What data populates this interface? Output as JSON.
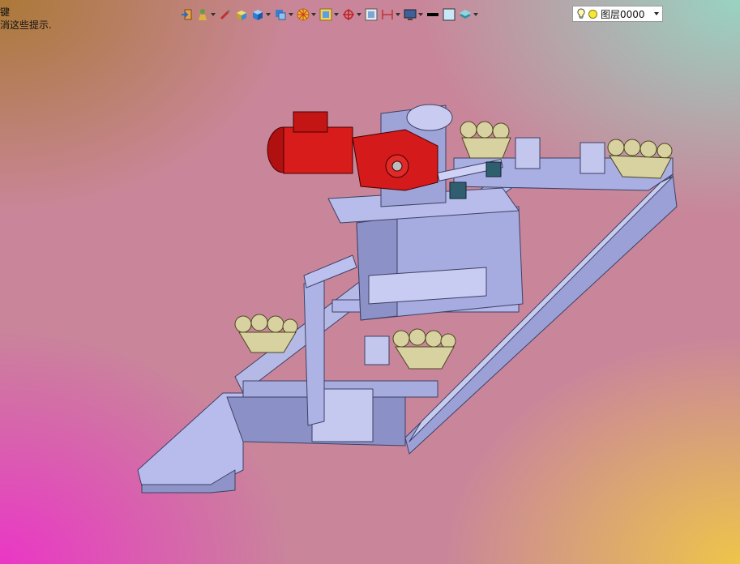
{
  "hints": {
    "line1": "键",
    "line2": "消这些提示."
  },
  "toolbar": {
    "items": [
      {
        "name": "exit-icon",
        "dropdown": false
      },
      {
        "name": "person-icon",
        "dropdown": true
      },
      {
        "name": "paint-brush-icon",
        "dropdown": false
      },
      {
        "name": "box-face-icon",
        "dropdown": false
      },
      {
        "name": "cube-icon",
        "dropdown": true
      },
      {
        "name": "view-cube-icon",
        "dropdown": true
      },
      {
        "name": "render-wheel-icon",
        "dropdown": true
      },
      {
        "name": "section-view-icon",
        "dropdown": true
      },
      {
        "name": "axis-icon",
        "dropdown": true
      },
      {
        "name": "frame-icon",
        "dropdown": false
      },
      {
        "name": "dimension-icon",
        "dropdown": true
      },
      {
        "name": "monitor-icon",
        "dropdown": true
      },
      {
        "name": "line-weight-icon",
        "dropdown": false
      },
      {
        "name": "color-swatch-icon",
        "dropdown": false
      },
      {
        "name": "layers-icon",
        "dropdown": true
      }
    ],
    "layer": {
      "label": "图层0000",
      "bulb_icon": "bulb-icon",
      "sun_icon": "sun-icon"
    }
  },
  "colors": {
    "frame": "#a8aee0",
    "frame_dark": "#5a5f88",
    "motor": "#d01818",
    "wheels": "#d8d2a0",
    "bearing": "#2f5f6f"
  }
}
